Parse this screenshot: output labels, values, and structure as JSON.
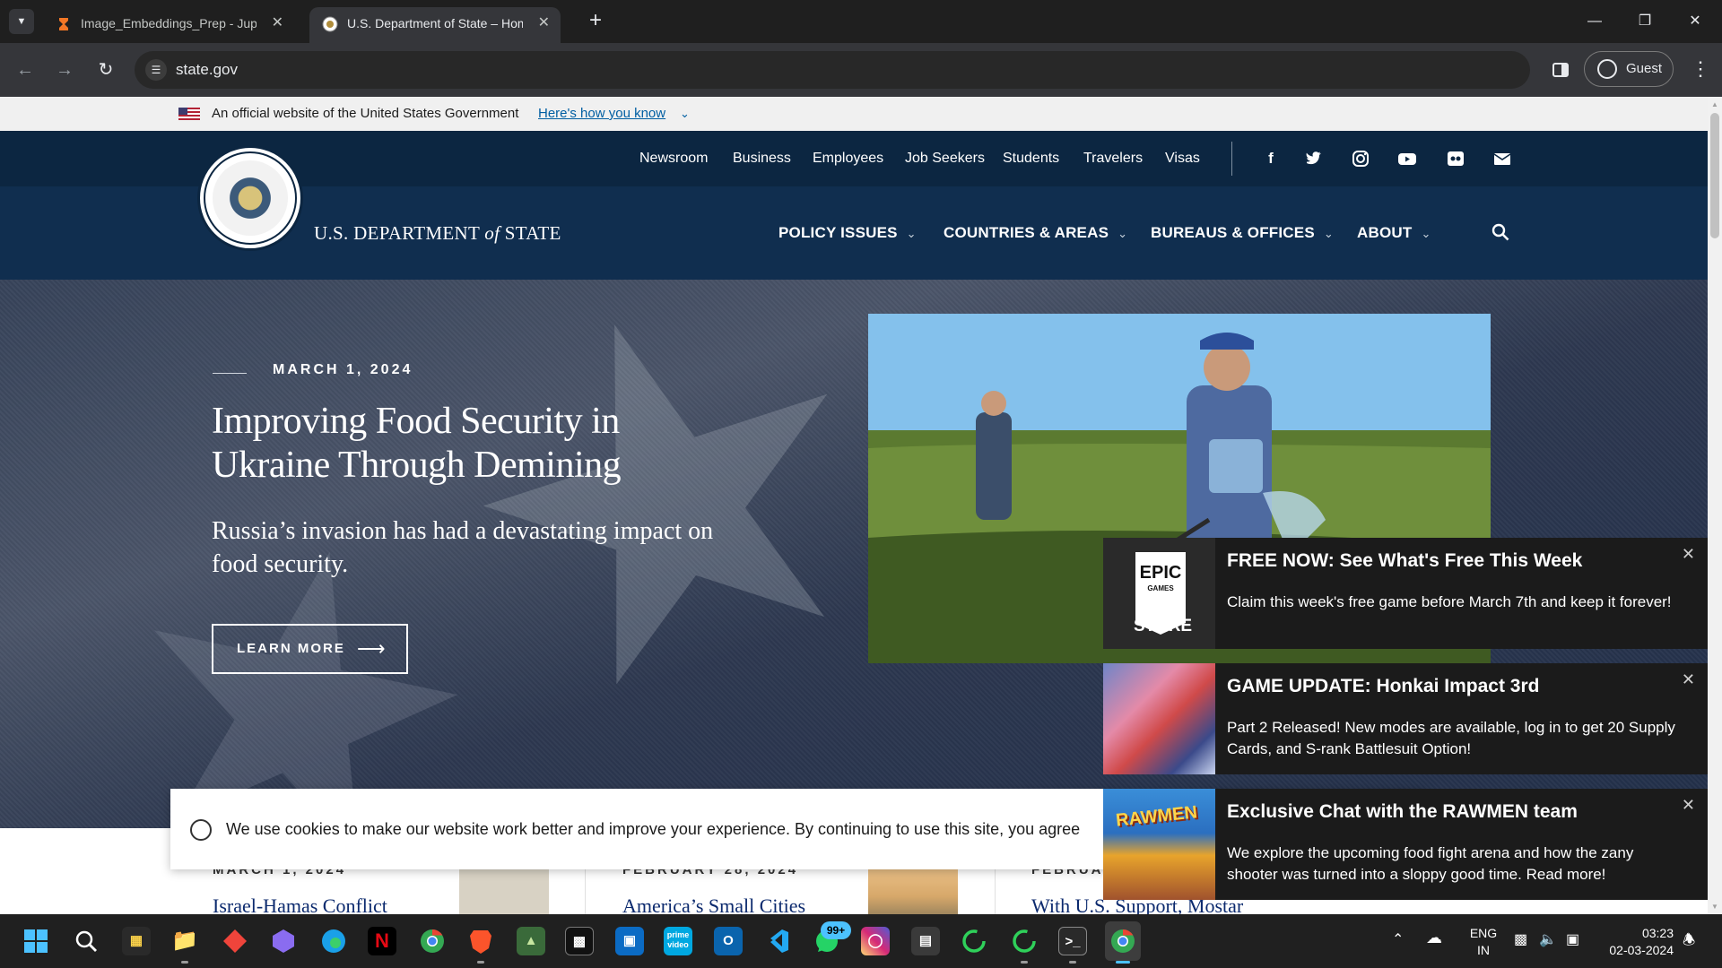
{
  "browser": {
    "tabs": [
      {
        "title": "Image_Embeddings_Prep - Jupyter",
        "active": false
      },
      {
        "title": "U.S. Department of State – Home",
        "active": true
      }
    ],
    "url": "state.gov",
    "profile_label": "Guest"
  },
  "site": {
    "gov_banner": {
      "text": "An official website of the United States Government",
      "link": "Here's how you know"
    },
    "top_links": [
      "Newsroom",
      "Business",
      "Employees",
      "Job Seekers",
      "Students",
      "Travelers",
      "Visas"
    ],
    "social_icons": [
      "facebook-icon",
      "twitter-icon",
      "instagram-icon",
      "youtube-icon",
      "flickr-icon",
      "email-icon"
    ],
    "brand": {
      "pre": "U.S. DEPARTMENT",
      "of": "of",
      "post": "STATE"
    },
    "main_nav": [
      "POLICY ISSUES",
      "COUNTRIES & AREAS",
      "BUREAUS & OFFICES",
      "ABOUT"
    ],
    "hero": {
      "date": "MARCH 1, 2024",
      "title": "Improving Food Security in Ukraine Through Demining",
      "subtitle": "Russia’s invasion has had a devastating impact on food security.",
      "button": "LEARN MORE"
    },
    "cards": [
      {
        "date": "MARCH 1, 2024",
        "title": "Israel-Hamas Conflict"
      },
      {
        "date": "FEBRUARY 28, 2024",
        "title": "America’s Small Cities"
      },
      {
        "date": "FEBRUA",
        "title": "With U.S. Support, Mostar"
      }
    ],
    "cookie_text": "We use cookies to make our website work better and improve your experience. By continuing to use this site, you agree"
  },
  "notifications": [
    {
      "title": "FREE NOW: See What's Free This Week",
      "body": "Claim this week's free game before March 7th and keep it forever!",
      "thumb": "EPIC GAMES STORE"
    },
    {
      "title": "GAME UPDATE: Honkai Impact 3rd",
      "body": "Part 2 Released! New modes are available, log in to get 20 Supply Cards, and S-rank Battlesuit Option!"
    },
    {
      "title": "Exclusive Chat with the RAWMEN team",
      "body": "We explore the upcoming food fight arena and how the zany shooter was turned into a sloppy good time. Read more!",
      "thumb": "RAWMEN"
    }
  ],
  "epic_logo": {
    "line1": "EPIC",
    "line2": "GAMES",
    "line3": "STORE"
  },
  "taskbar": {
    "whatsapp_badge": "99+",
    "lang": "ENG",
    "region": "IN",
    "time": "03:23",
    "date": "02-03-2024"
  }
}
